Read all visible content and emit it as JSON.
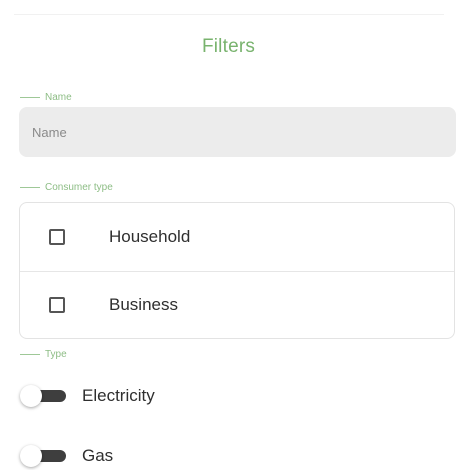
{
  "header": {
    "title": "Filters"
  },
  "name_section": {
    "label": "Name",
    "placeholder": "Name",
    "value": ""
  },
  "consumer_section": {
    "label": "Consumer type",
    "options": [
      {
        "label": "Household",
        "checked": false
      },
      {
        "label": "Business",
        "checked": false
      }
    ]
  },
  "type_section": {
    "label": "Type",
    "options": [
      {
        "label": "Electricity",
        "enabled": false
      },
      {
        "label": "Gas",
        "enabled": false
      }
    ]
  },
  "colors": {
    "accent": "#79b36e",
    "input_background": "#ececec",
    "switch_track": "#3e3e3e"
  }
}
